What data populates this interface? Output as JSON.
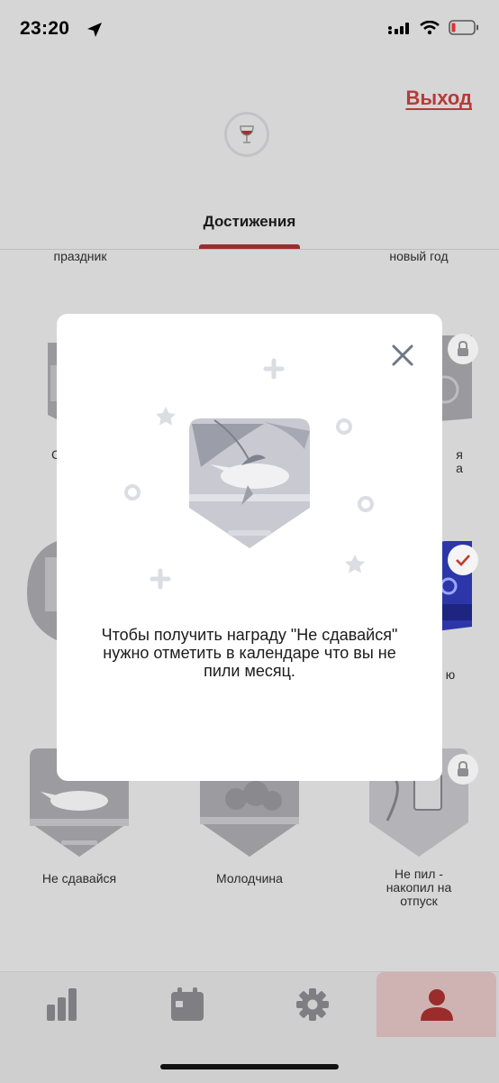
{
  "status_bar": {
    "time": "23:20"
  },
  "header": {
    "exit_label": "Выход",
    "tab_title": "Достижения"
  },
  "achievements": {
    "top_left_label": "праздник",
    "top_right_label": "новый год",
    "bottom_row": [
      {
        "label": "Не сдавайся"
      },
      {
        "label": "Молодчина"
      },
      {
        "label": "Не пил -\nнакопил на\nотпуск"
      }
    ]
  },
  "modal": {
    "message": "Чтобы получить награду \"Не сдавайся\" нужно отметить в календаре что вы не пили месяц."
  },
  "bottom_nav": {
    "items": [
      {
        "icon": "chart-icon",
        "active": false
      },
      {
        "icon": "calendar-icon",
        "active": false
      },
      {
        "icon": "gear-icon",
        "active": false
      },
      {
        "icon": "profile-icon",
        "active": true
      }
    ]
  },
  "colors": {
    "accent": "#9b2c2c",
    "exit": "#b83a3a",
    "backdrop": "#d6d6d6"
  }
}
